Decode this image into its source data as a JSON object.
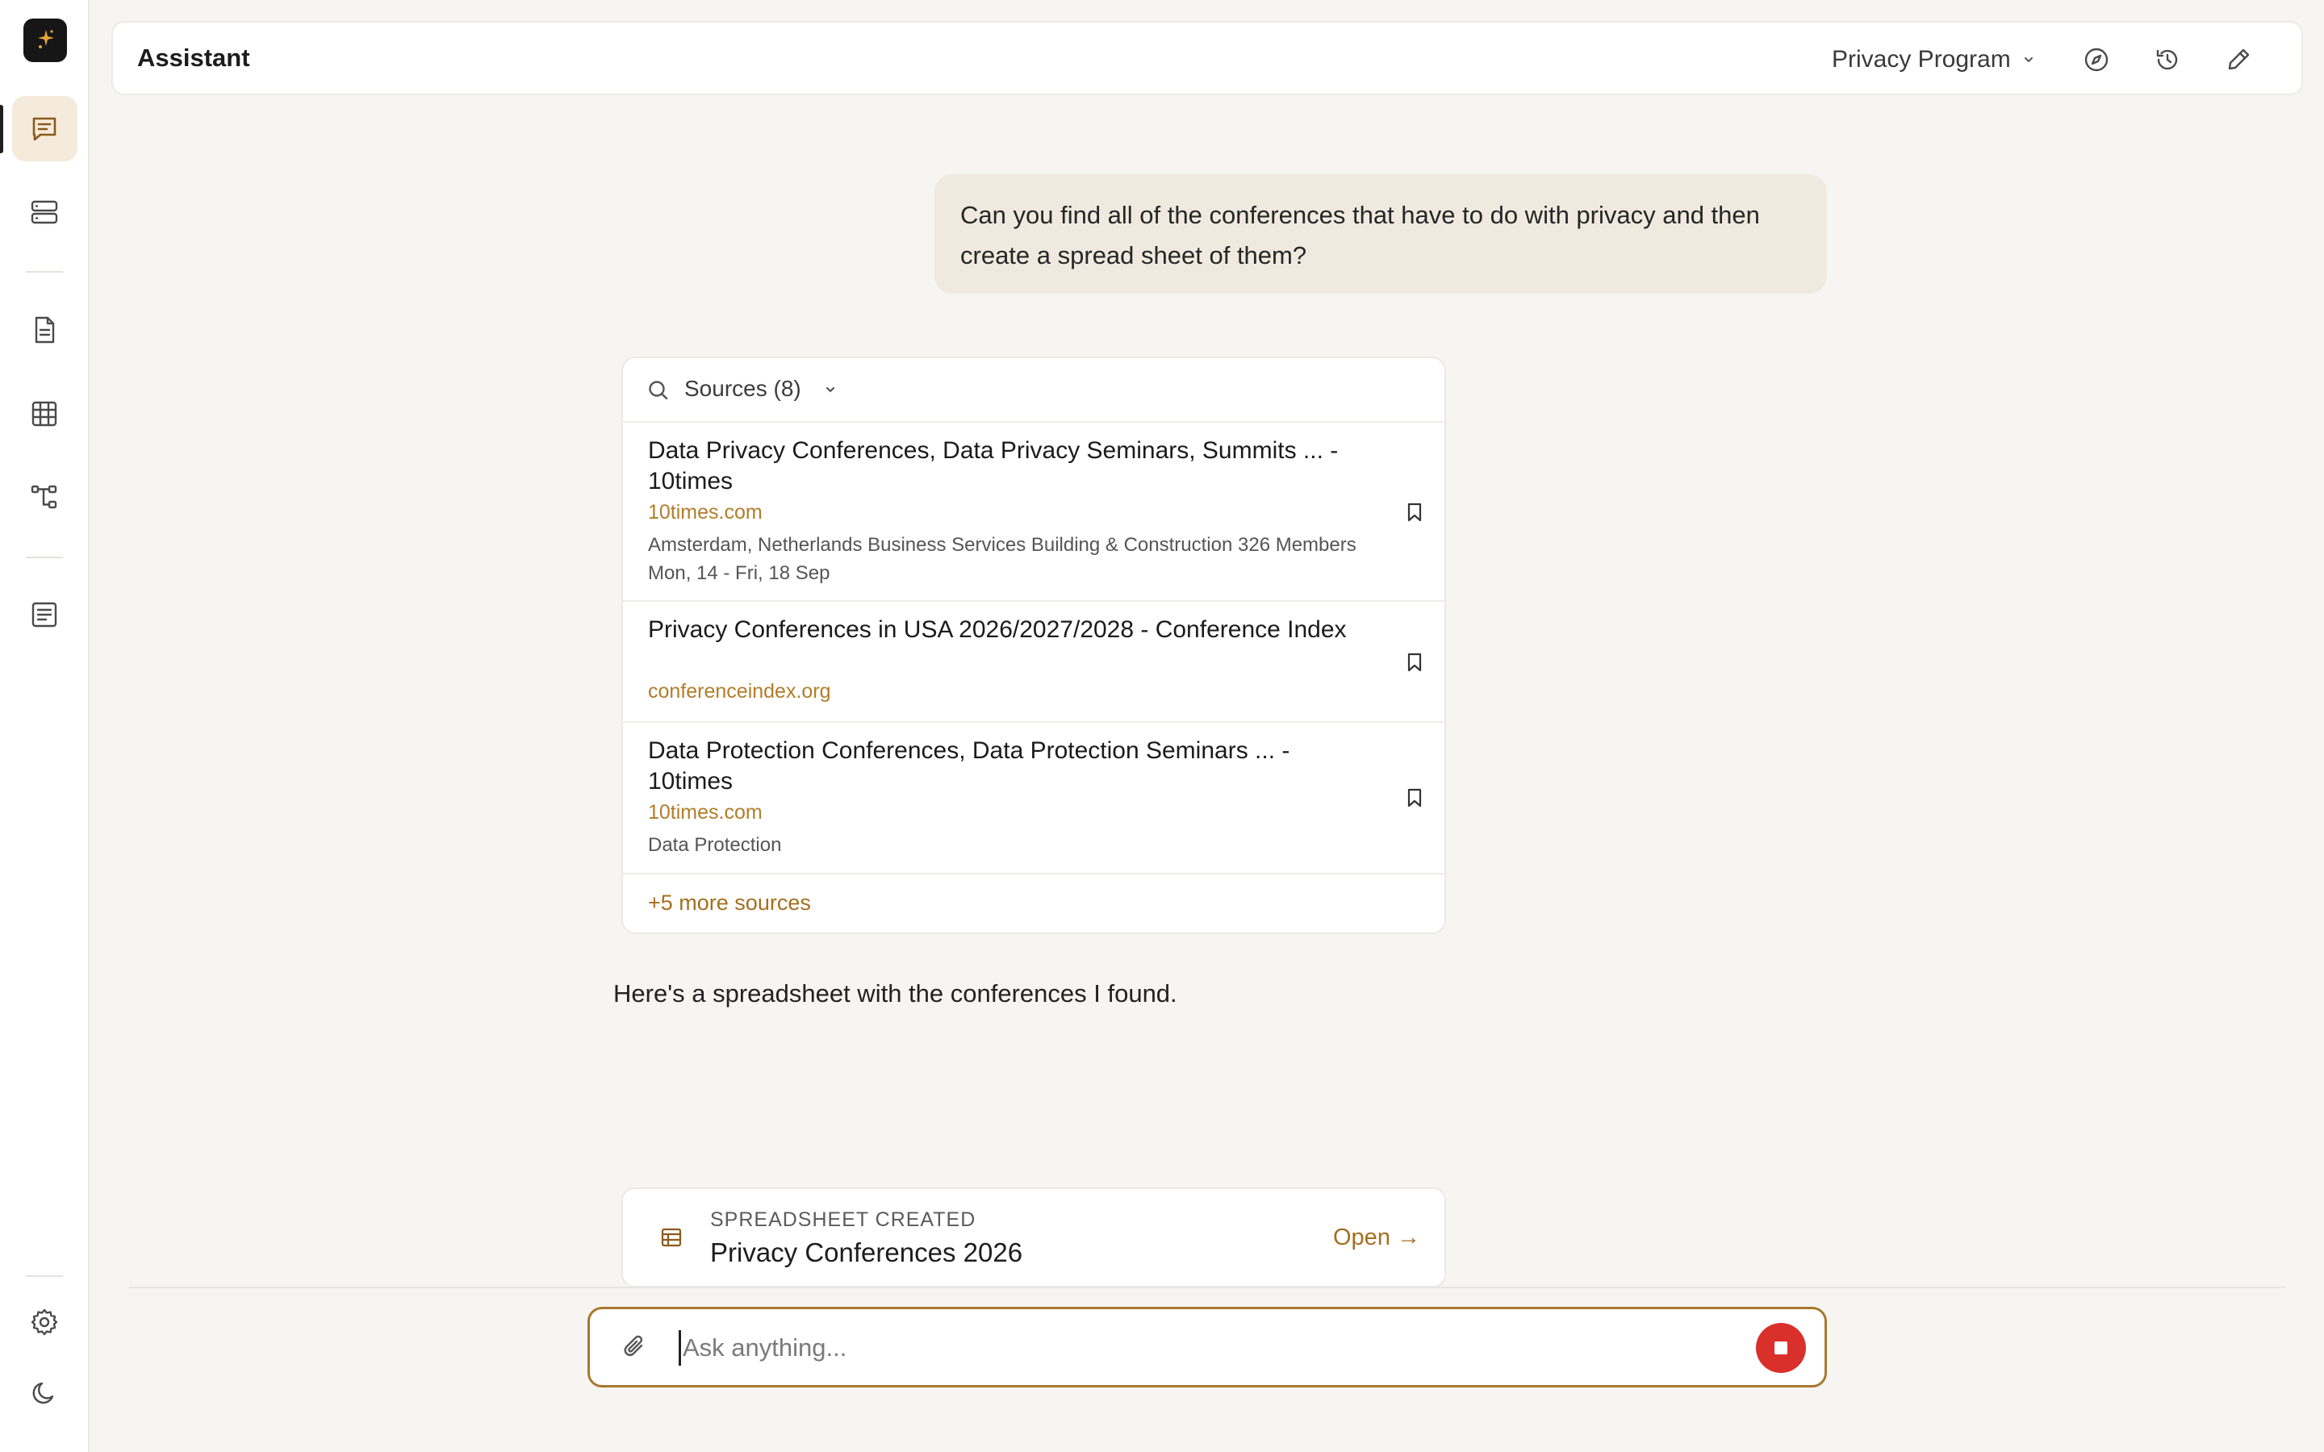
{
  "header": {
    "title": "Assistant",
    "project": "Privacy Program"
  },
  "sidebar": {
    "items": [
      "chat-icon",
      "database-icon",
      "document-icon",
      "table-icon",
      "workflow-icon",
      "notes-icon",
      "gear-icon",
      "moon-icon"
    ],
    "active": "chat"
  },
  "conversation": {
    "user_message": "Can you find all of the conferences that have to do with privacy and then create a spread sheet of them?",
    "sources": {
      "title": "Sources (8)",
      "items": [
        {
          "title": "Data Privacy Conferences, Data Privacy Seminars, Summits ... - 10times",
          "domain": "10times.com",
          "description": "Amsterdam, Netherlands Business Services Building & Construction 326 Members Mon, 14 - Fri, 18 Sep"
        },
        {
          "title": "Privacy Conferences in USA 2026/2027/2028 - Conference Index",
          "domain": "conferenceindex.org",
          "description": ""
        },
        {
          "title": "Data Protection Conferences, Data Protection Seminars ... - 10times",
          "domain": "10times.com",
          "description": "Data Protection"
        }
      ],
      "more": "+5 more sources"
    },
    "assistant_message": "Here's a spreadsheet with the conferences I found.",
    "spreadsheet": {
      "kicker": "SPREADSHEET CREATED",
      "name": "Privacy Conferences 2026",
      "open_label": "Open →"
    }
  },
  "composer": {
    "placeholder": "Ask anything..."
  },
  "colors": {
    "accent": "#a8782e",
    "link": "#b27d2a",
    "stop": "#d9302c",
    "active_bg": "#f5ebdc"
  }
}
